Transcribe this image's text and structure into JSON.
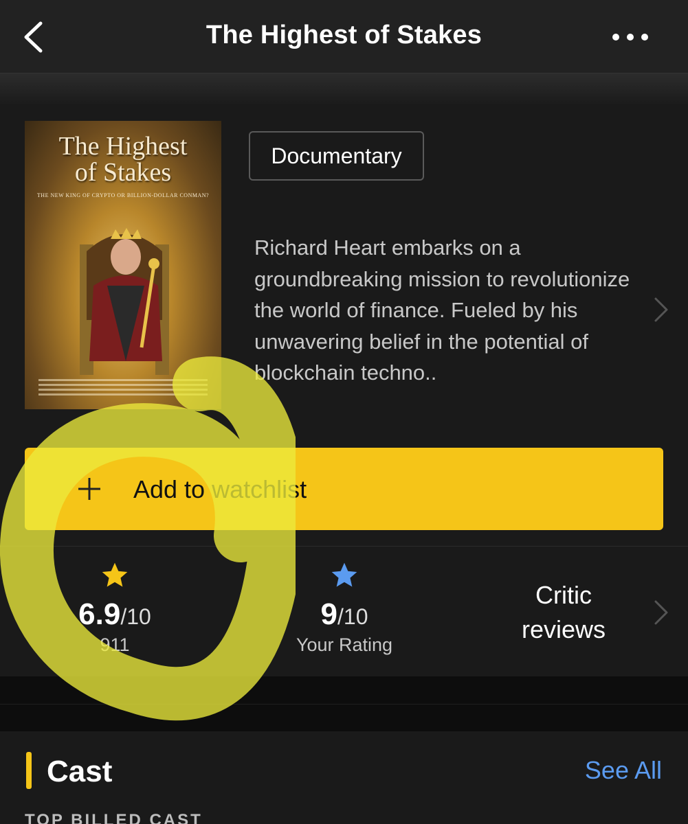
{
  "navbar": {
    "title": "The Highest of Stakes",
    "back_icon": "chevron-left-icon",
    "more_icon": "more-horizontal-icon"
  },
  "poster": {
    "title_line1": "The Highest",
    "title_line2": "of Stakes",
    "tagline": "THE NEW KING OF CRYPTO OR BILLION-DOLLAR CONMAN?"
  },
  "genre": "Documentary",
  "plot": "Richard Heart embarks on a groundbreaking mission to revolutionize the world of finance. Fueled by his unwavering belief in the potential of blockchain techno..",
  "watchlist": {
    "label": "Add to watchlist",
    "icon": "plus-icon"
  },
  "ratings": {
    "imdb": {
      "score": "6.9",
      "scale": "/10",
      "count": "911",
      "star_color": "#f5c518"
    },
    "user": {
      "score": "9",
      "scale": "/10",
      "label": "Your Rating",
      "star_color": "#5b9bf0"
    },
    "critic": {
      "line1": "Critic",
      "line2": "reviews"
    }
  },
  "cast": {
    "title": "Cast",
    "see_all": "See All",
    "subheading": "TOP BILLED CAST"
  },
  "colors": {
    "accent": "#f5c518",
    "link": "#5b9bf0",
    "background": "#1a1a1a"
  }
}
